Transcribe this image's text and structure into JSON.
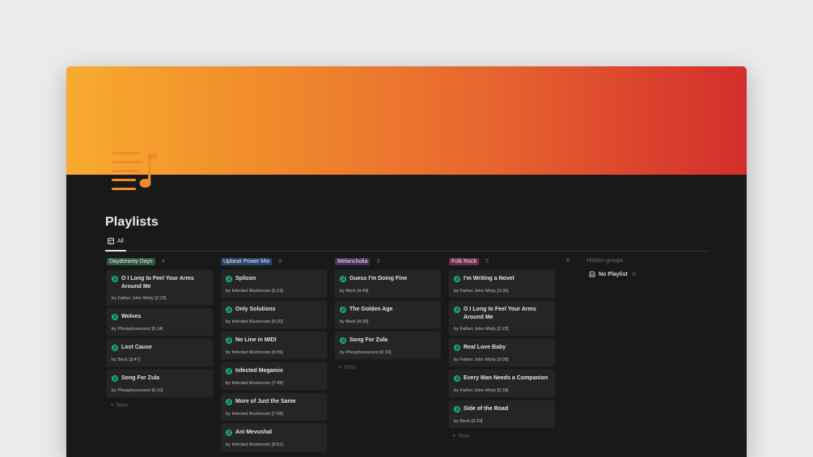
{
  "page": {
    "title": "Playlists",
    "cover_colors": [
      "#f8ab2e",
      "#f08a2c",
      "#e8682f",
      "#d32e2c"
    ],
    "icon": "music-list-icon"
  },
  "views": [
    {
      "label": "All",
      "icon": "table-icon",
      "active": true
    }
  ],
  "columns": [
    {
      "tag": "Daydreamy Days",
      "tag_color": "#2b593f",
      "count": "4",
      "cards": [
        {
          "title": "O I Long to Feel Your Arms Around Me",
          "artist": "by Father John Misty [2:23]"
        },
        {
          "title": "Wolves",
          "artist": "by Phosphorescent [6:14]"
        },
        {
          "title": "Lost Cause",
          "artist": "by Beck [3:47]"
        },
        {
          "title": "Song For Zula",
          "artist": "by Phosphorescent [6:10]"
        }
      ],
      "new_label": "New"
    },
    {
      "tag": "Upbeat Power Mix",
      "tag_color": "#28456c",
      "count": "8",
      "cards": [
        {
          "title": "Splicon",
          "artist": "by Infected Mushroom [6:23]"
        },
        {
          "title": "Only Solutions",
          "artist": "by Infected Mushroom [5:20]"
        },
        {
          "title": "No Line in MIDI",
          "artist": "by Infected Mushroom [6:59]"
        },
        {
          "title": "Infected Megamix",
          "artist": "by Infected Mushroom [7:49]"
        },
        {
          "title": "More of Just the Same",
          "artist": "by Infected Mushroom [7:08]"
        },
        {
          "title": "Ani Mevushal",
          "artist": "by Infected Mushroom [8:51]"
        }
      ]
    },
    {
      "tag": "Melancholia",
      "tag_color": "#492f64",
      "count": "3",
      "cards": [
        {
          "title": "Guess I'm Doing Fine",
          "artist": "by Beck [4:49]"
        },
        {
          "title": "The Golden Age",
          "artist": "by Beck [4:35]"
        },
        {
          "title": "Song For Zula",
          "artist": "by Phosphorescent [6:10]"
        }
      ],
      "new_label": "New"
    },
    {
      "tag": "Folk Rock",
      "tag_color": "#69314c",
      "count": "5",
      "cards": [
        {
          "title": "I'm Writing a Novel",
          "artist": "by Father John Misty [3:35]"
        },
        {
          "title": "O I Long to Feel Your Arms Around Me",
          "artist": "by Father John Misty [2:23]"
        },
        {
          "title": "Real Love Baby",
          "artist": "by Father John Misty [3:09]"
        },
        {
          "title": "Every Man Needs a Companion",
          "artist": "by Father John Misty [5:18]"
        },
        {
          "title": "Side of the Road",
          "artist": "by Beck [3:23]"
        }
      ],
      "new_label": "New"
    }
  ],
  "add_group_label": "+",
  "hidden_groups": {
    "title": "Hidden groups",
    "items": [
      {
        "label": "No Playlist",
        "count": "0",
        "icon": "inbox-icon"
      }
    ]
  },
  "colors": {
    "card_icon": "#1fae8a",
    "background": "#191919",
    "card": "#252525"
  }
}
